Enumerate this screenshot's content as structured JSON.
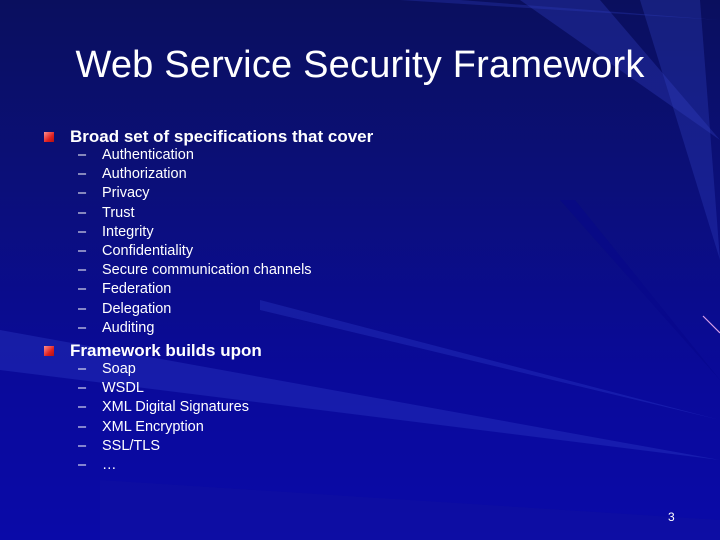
{
  "slide": {
    "title": "Web Service Security Framework",
    "page_number": "3",
    "bullet_icon": "red-square-bullet",
    "dash": "–",
    "sections": [
      {
        "heading": "Broad set of specifications that cover",
        "items": [
          "Authentication",
          "Authorization",
          "Privacy",
          "Trust",
          "Integrity",
          "Confidentiality",
          "Secure communication channels",
          "Federation",
          "Delegation",
          "Auditing"
        ]
      },
      {
        "heading": "Framework builds upon",
        "items": [
          "Soap",
          "WSDL",
          "XML Digital Signatures",
          "XML Encryption",
          "SSL/TLS",
          "…"
        ]
      }
    ]
  },
  "colors": {
    "background": "#0a0a9a",
    "text": "#ffffff",
    "bullet": "#e02020"
  }
}
